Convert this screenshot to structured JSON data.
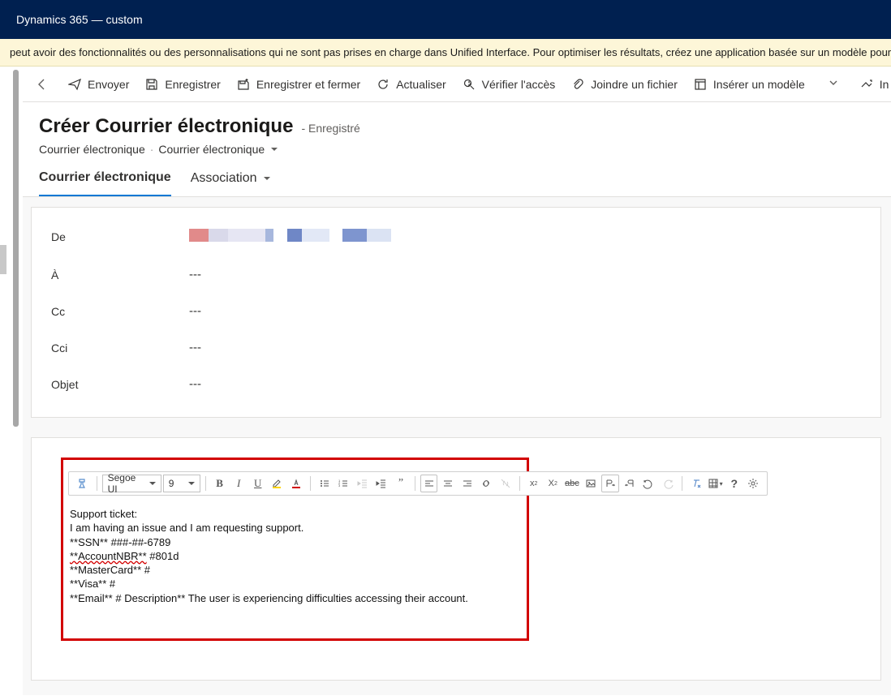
{
  "topbar": {
    "title": "Dynamics 365 — custom"
  },
  "warning": "peut avoir des fonctionnalités ou des personnalisations qui ne sont pas prises en charge dans Unified Interface. Pour optimiser les résultats, créez une application basée sur un modèle pour Unified Interface.",
  "commands": {
    "send": "Envoyer",
    "save": "Enregistrer",
    "save_close": "Enregistrer et fermer",
    "refresh": "Actualiser",
    "check_access": "Vérifier l'accès",
    "attach": "Joindre un fichier",
    "insert_template": "Insérer un modèle",
    "more_partial": "In"
  },
  "header": {
    "title": "Créer Courrier électronique",
    "status": "- Enregistré",
    "breadcrumb_1": "Courrier électronique",
    "breadcrumb_2": "Courrier électronique"
  },
  "tabs": {
    "email": "Courrier électronique",
    "association": "Association"
  },
  "fields": {
    "from_label": "De",
    "to_label": "À",
    "cc_label": "Cc",
    "bcc_label": "Cci",
    "subject_label": "Objet",
    "empty": "---"
  },
  "rte": {
    "font_name": "Segoe UI",
    "font_size": "9",
    "body_lines": [
      "Support ticket:",
      "I am having an issue and I am requesting support.",
      "**SSN** ###-##-6789",
      "**AccountNBR** #801d",
      "**MasterCard** #",
      "**Visa** #",
      "**Email** # Description** The user is experiencing difficulties accessing their account."
    ],
    "squiggle_index": 3
  }
}
